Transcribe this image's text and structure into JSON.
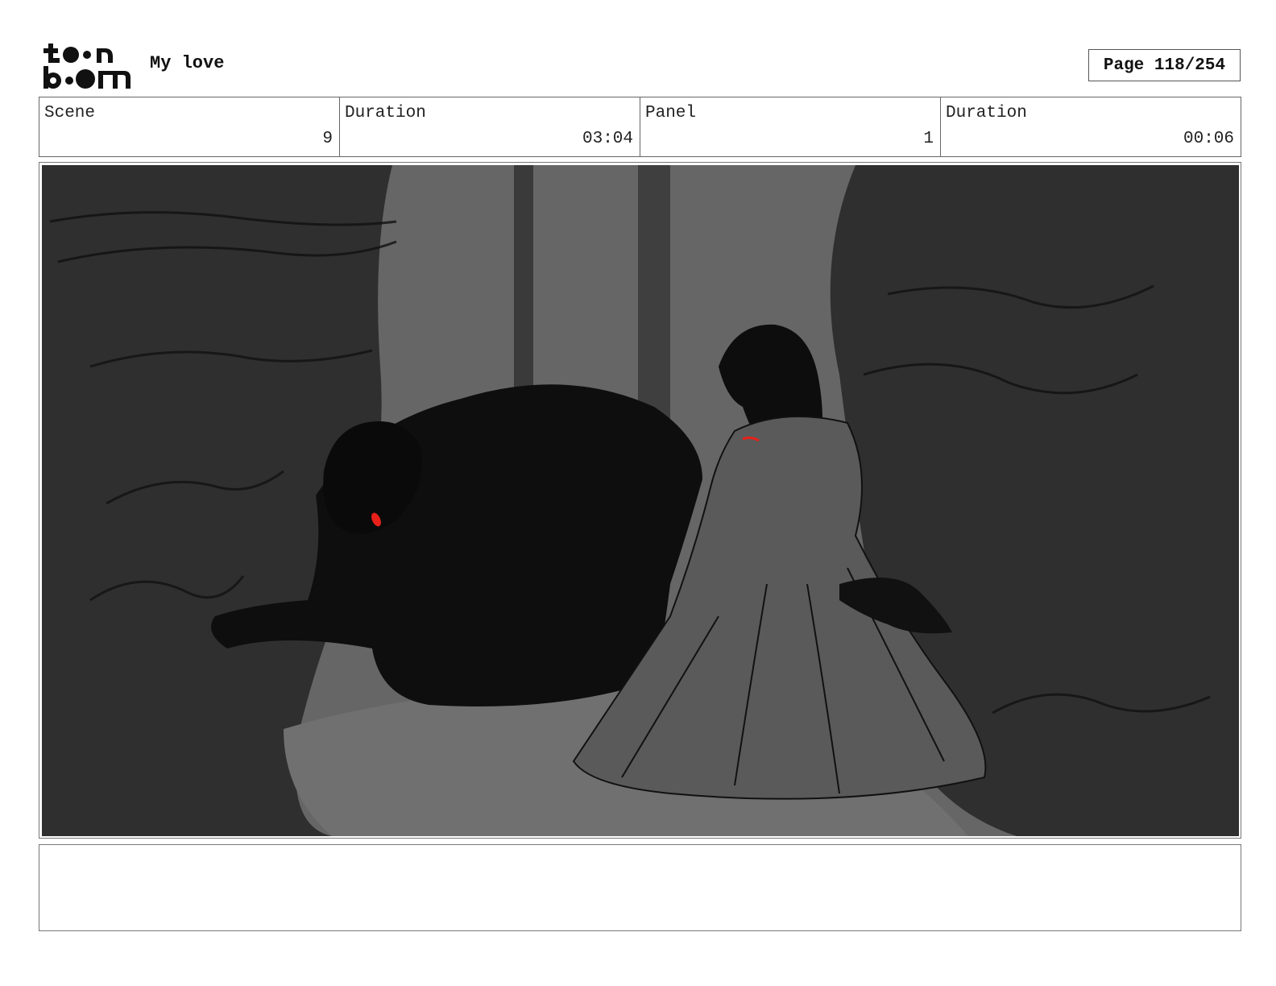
{
  "header": {
    "logo_alt": "toon boom",
    "project_title": "My love",
    "page_label": "Page 118/254"
  },
  "info": {
    "scene_label": "Scene",
    "scene_value": "9",
    "scene_duration_label": "Duration",
    "scene_duration_value": "03:04",
    "panel_label": "Panel",
    "panel_value": "1",
    "panel_duration_label": "Duration",
    "panel_duration_value": "00:06"
  },
  "notes": {
    "text": ""
  },
  "colors": {
    "background_dark": "#2e2e2e",
    "light_beam": "#6b6b6b",
    "figure_black": "#0d0d0d",
    "eye_red": "#e8201a"
  }
}
